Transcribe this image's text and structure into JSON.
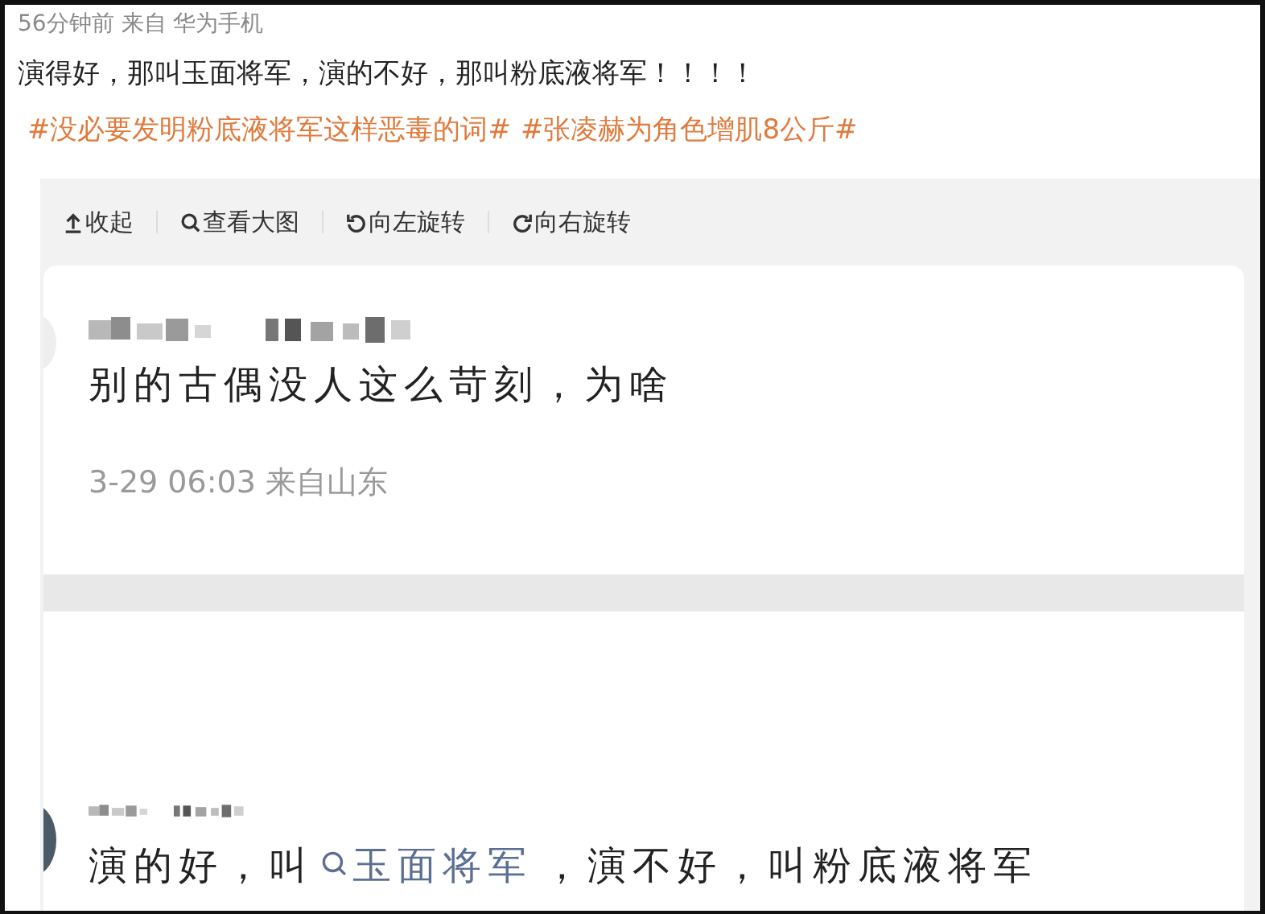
{
  "post": {
    "meta": "56分钟前 来自 华为手机",
    "text_parts": [
      {
        "kind": "plain",
        "text": "演得好，那叫玉面将军，演的不好，那叫粉底液将军！！！！"
      },
      {
        "kind": "hashtag",
        "text": "#没必要发明粉底液将军这样恶毒的词#"
      },
      {
        "kind": "hashtag",
        "text": "#张凌赫为角色增肌8公斤#"
      }
    ]
  },
  "image_toolbar": [
    {
      "kind": "collapse",
      "label": "收起"
    },
    {
      "kind": "zoom",
      "label": "查看大图"
    },
    {
      "kind": "rotate_left",
      "label": "向左旋转"
    },
    {
      "kind": "rotate_right",
      "label": "向右旋转"
    }
  ],
  "screenshot": {
    "comments": [
      {
        "text_parts": [
          {
            "kind": "plain",
            "text": "别的古偶没人这么苛刻，为啥"
          }
        ],
        "time": "3-29 06:03 来自山东"
      },
      {
        "text_parts": [
          {
            "kind": "plain",
            "text": "演的好，叫"
          },
          {
            "kind": "search_link",
            "text": "玉面将军"
          },
          {
            "kind": "plain",
            "text": "，演不好，叫粉底液将军"
          }
        ]
      }
    ]
  }
}
